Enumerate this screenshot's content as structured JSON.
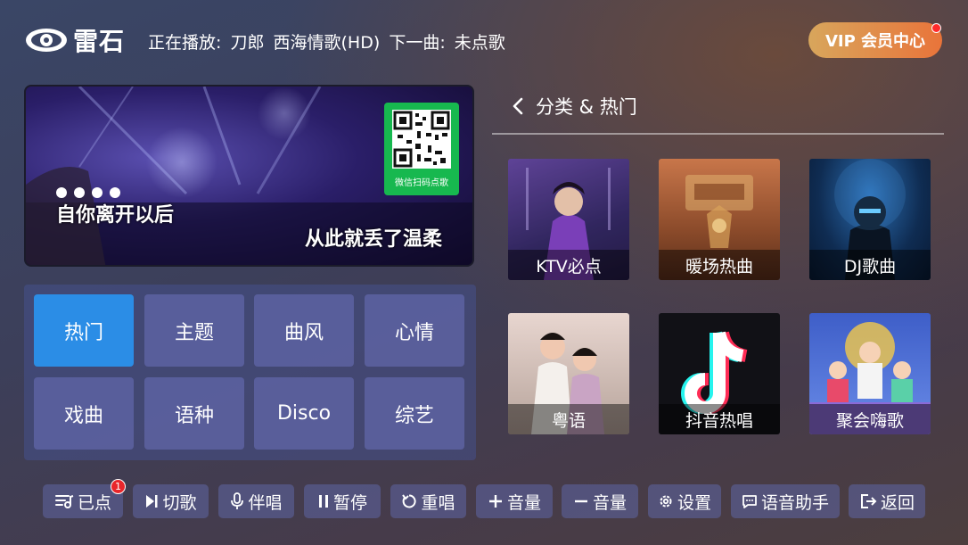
{
  "header": {
    "logo_text": "雷石",
    "now_playing_label": "正在播放:",
    "now_playing_artist": "刀郎",
    "now_playing_song": "西海情歌(HD)",
    "next_label": "下一曲:",
    "next_song": "未点歌",
    "vip_label": "VIP 会员中心"
  },
  "video": {
    "lyric_line1": "自你离开以后",
    "lyric_line2": "从此就丢了温柔",
    "qr_label": "微信扫码点歌"
  },
  "categories": [
    "热门",
    "主题",
    "曲风",
    "心情",
    "戏曲",
    "语种",
    "Disco",
    "综艺"
  ],
  "section": {
    "title": "分类 & 热门"
  },
  "tiles": [
    "KTV必点",
    "暖场热曲",
    "DJ歌曲",
    "粤语",
    "抖音热唱",
    "聚会嗨歌"
  ],
  "bottom_bar": {
    "queued": "已点",
    "queued_count": "1",
    "skip": "切歌",
    "vocal": "伴唱",
    "pause": "暂停",
    "replay": "重唱",
    "vol_up": "音量",
    "vol_down": "音量",
    "settings": "设置",
    "voice": "语音助手",
    "back": "返回"
  },
  "colors": {
    "active_category": "#2b8de6",
    "qr_green": "#17b84f",
    "vip_start": "#d8a65c",
    "vip_end": "#e9743a",
    "badge_red": "#e8262b"
  }
}
